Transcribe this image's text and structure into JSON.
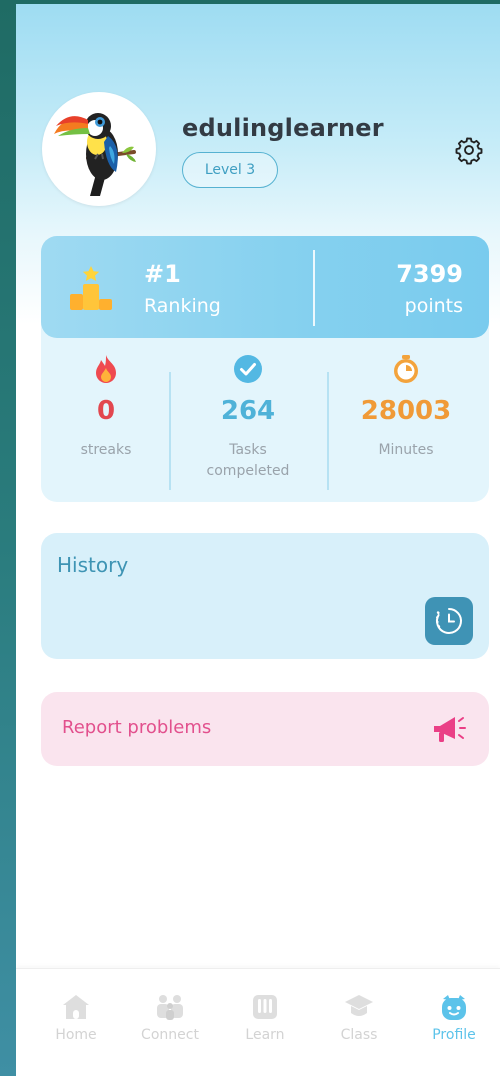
{
  "profile": {
    "username": "edulinglearner",
    "level": "Level 3",
    "avatar": "toucan-avatar"
  },
  "ranking": {
    "value": "#1",
    "label": "Ranking",
    "points_value": "7399",
    "points_label": "points"
  },
  "stats": [
    {
      "icon": "flame-icon",
      "value": "0",
      "label": "streaks",
      "color": "#e2474f"
    },
    {
      "icon": "check-circle-icon",
      "value": "264",
      "label": "Tasks compeleted",
      "color": "#4fb2d8"
    },
    {
      "icon": "stopwatch-icon",
      "value": "28003",
      "label": "Minutes",
      "color": "#f09a37"
    }
  ],
  "history": {
    "title": "History",
    "icon": "history-clock-icon"
  },
  "report": {
    "label": "Report problems",
    "icon": "megaphone-icon"
  },
  "nav": [
    {
      "label": "Home",
      "icon": "home-icon"
    },
    {
      "label": "Connect",
      "icon": "people-icon"
    },
    {
      "label": "Learn",
      "icon": "book-icon"
    },
    {
      "label": "Class",
      "icon": "graduation-cap-icon"
    },
    {
      "label": "Profile",
      "icon": "profile-face-icon",
      "active": true
    }
  ],
  "colors": {
    "accent": "#5cc3ea",
    "history_button": "#3f93b5",
    "report_text": "#e2508d",
    "report_bg": "#fae4ee"
  }
}
